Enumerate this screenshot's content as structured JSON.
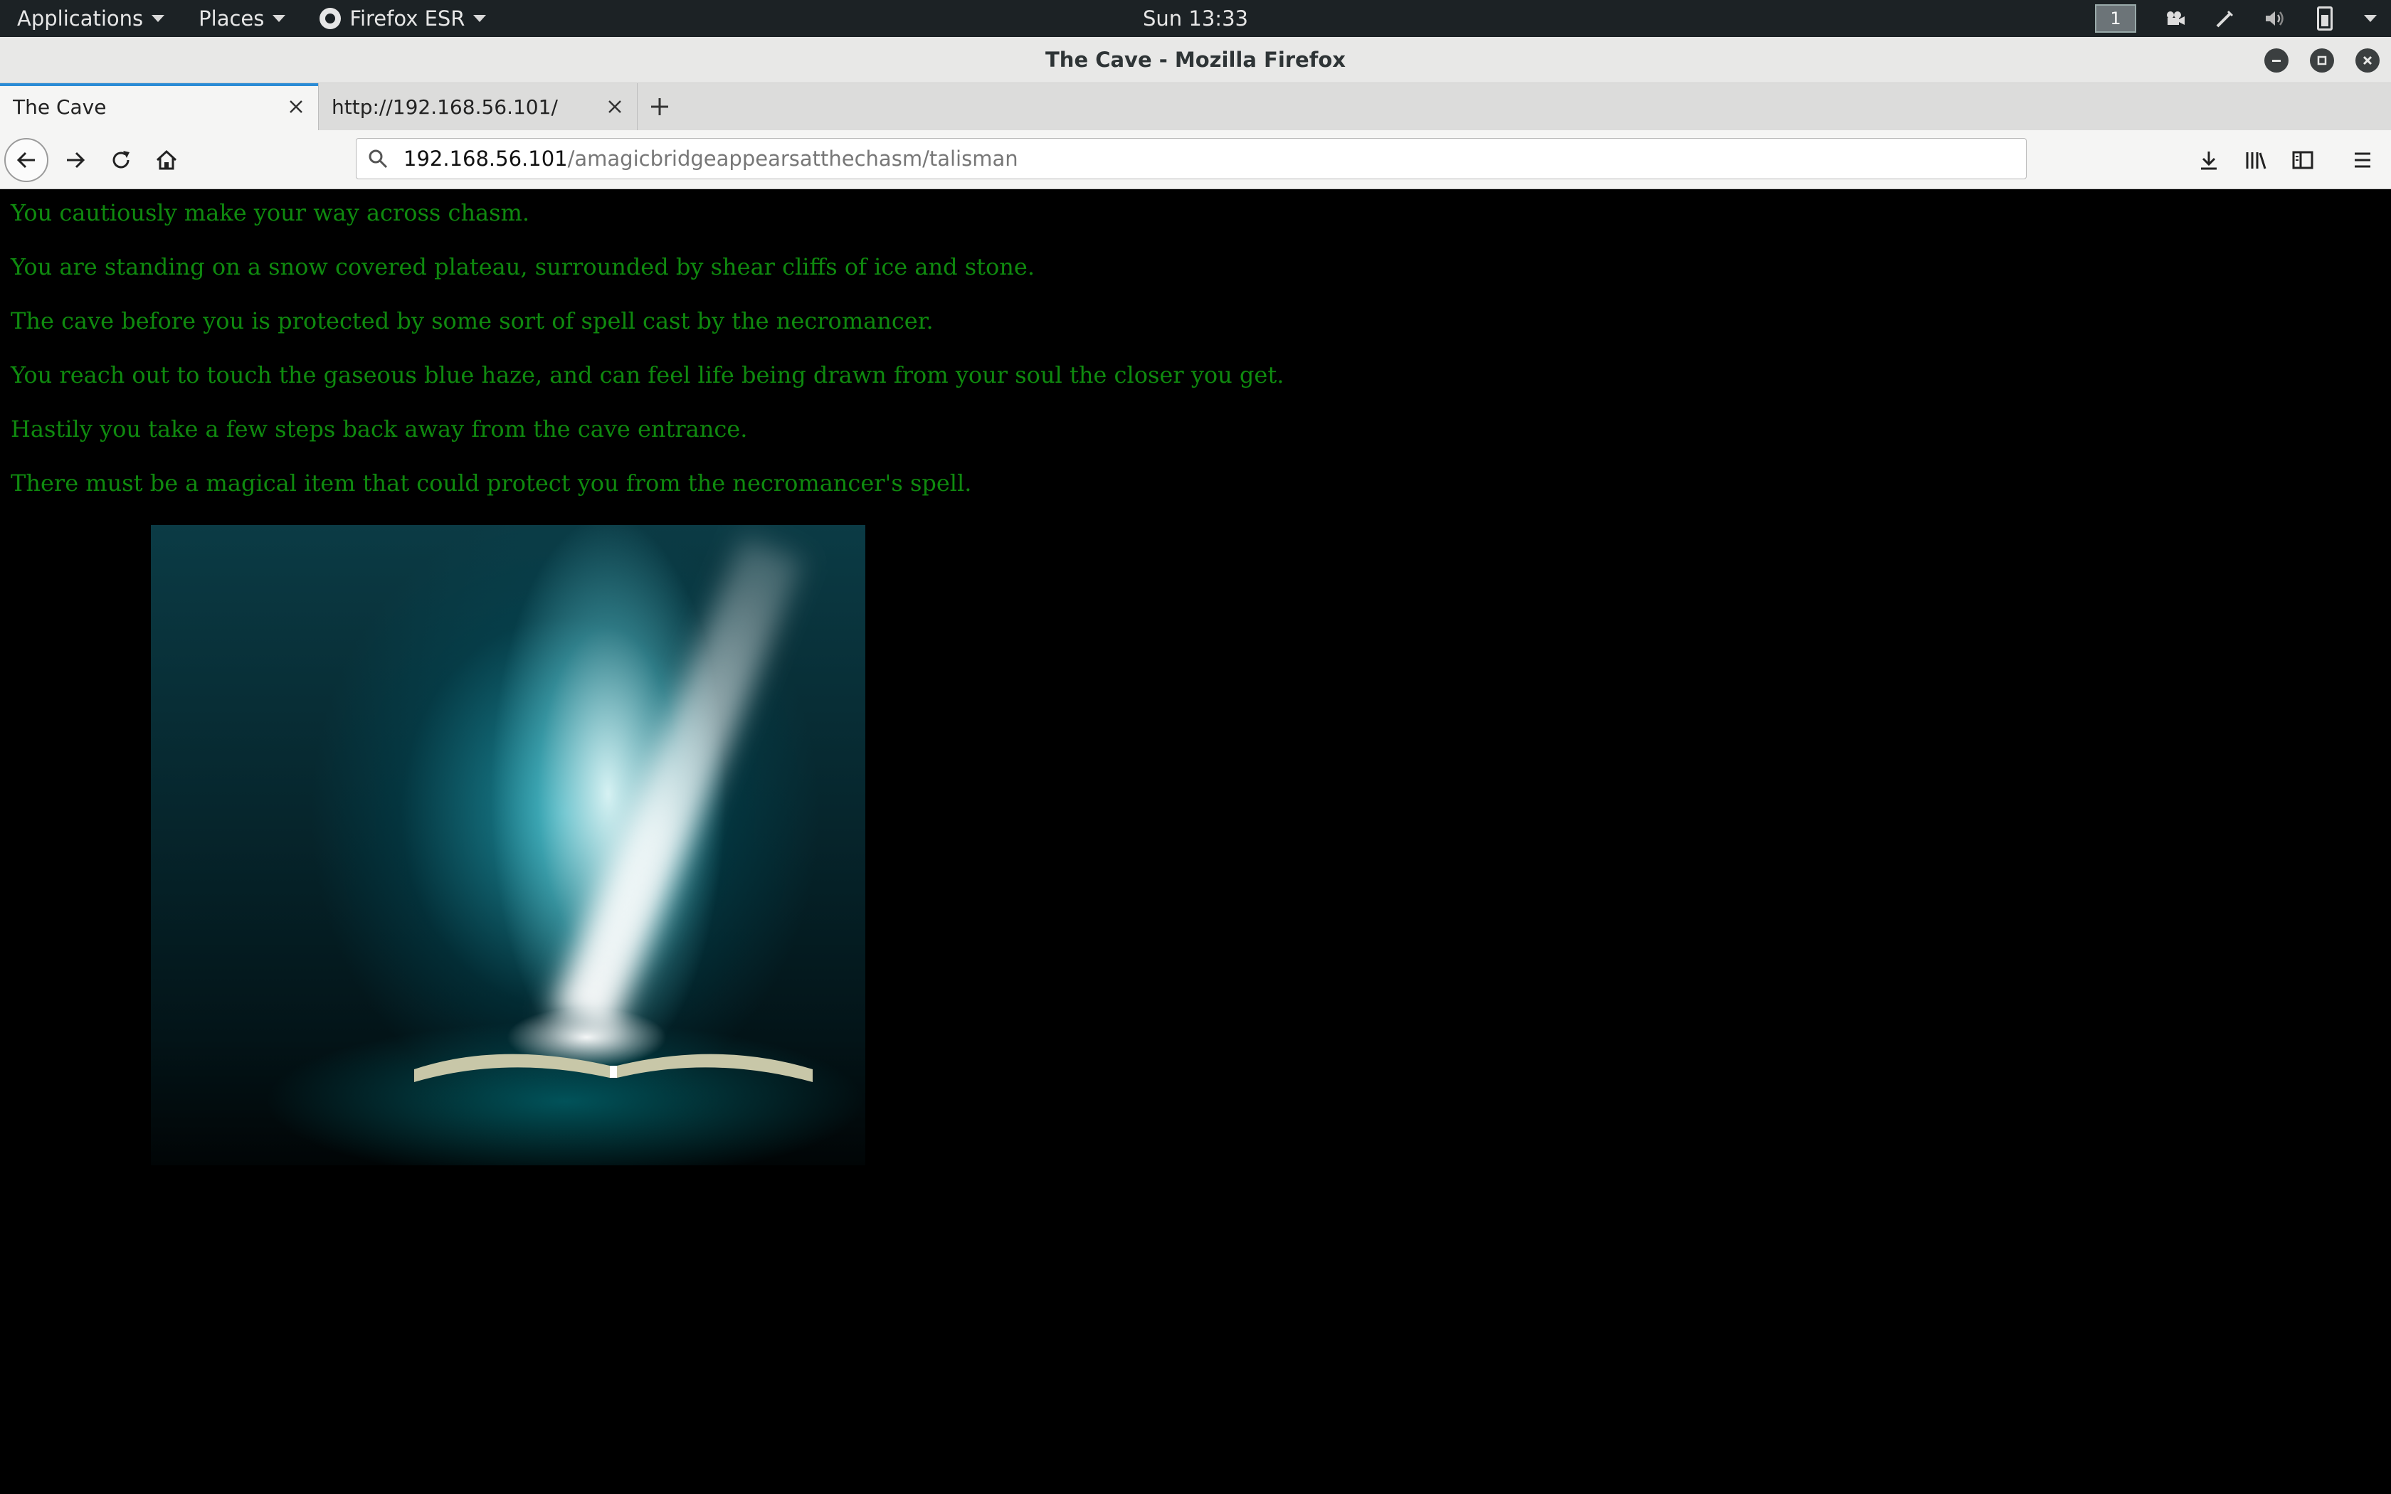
{
  "panel": {
    "applications": "Applications",
    "places": "Places",
    "firefox": "Firefox ESR",
    "clock": "Sun 13:33",
    "workspace": "1"
  },
  "window": {
    "title": "The Cave - Mozilla Firefox"
  },
  "tabs": [
    {
      "label": "The Cave",
      "active": true
    },
    {
      "label": "http://192.168.56.101/",
      "active": false
    }
  ],
  "urlbar": {
    "host": "192.168.56.101",
    "path": "/amagicbridgeappearsatthechasm/talisman"
  },
  "page": {
    "lines": [
      "You cautiously make your way across chasm.",
      "You are standing on a snow covered plateau, surrounded by shear cliffs of ice and stone.",
      "The cave before you is protected by some sort of spell cast by the necromancer.",
      "You reach out to touch the gaseous blue haze, and can feel life being drawn from your soul the closer you get.",
      "Hastily you take a few steps back away from the cave entrance.",
      "There must be a magical item that could protect you from the necromancer's spell."
    ],
    "text_color": "#0f8a0f"
  }
}
